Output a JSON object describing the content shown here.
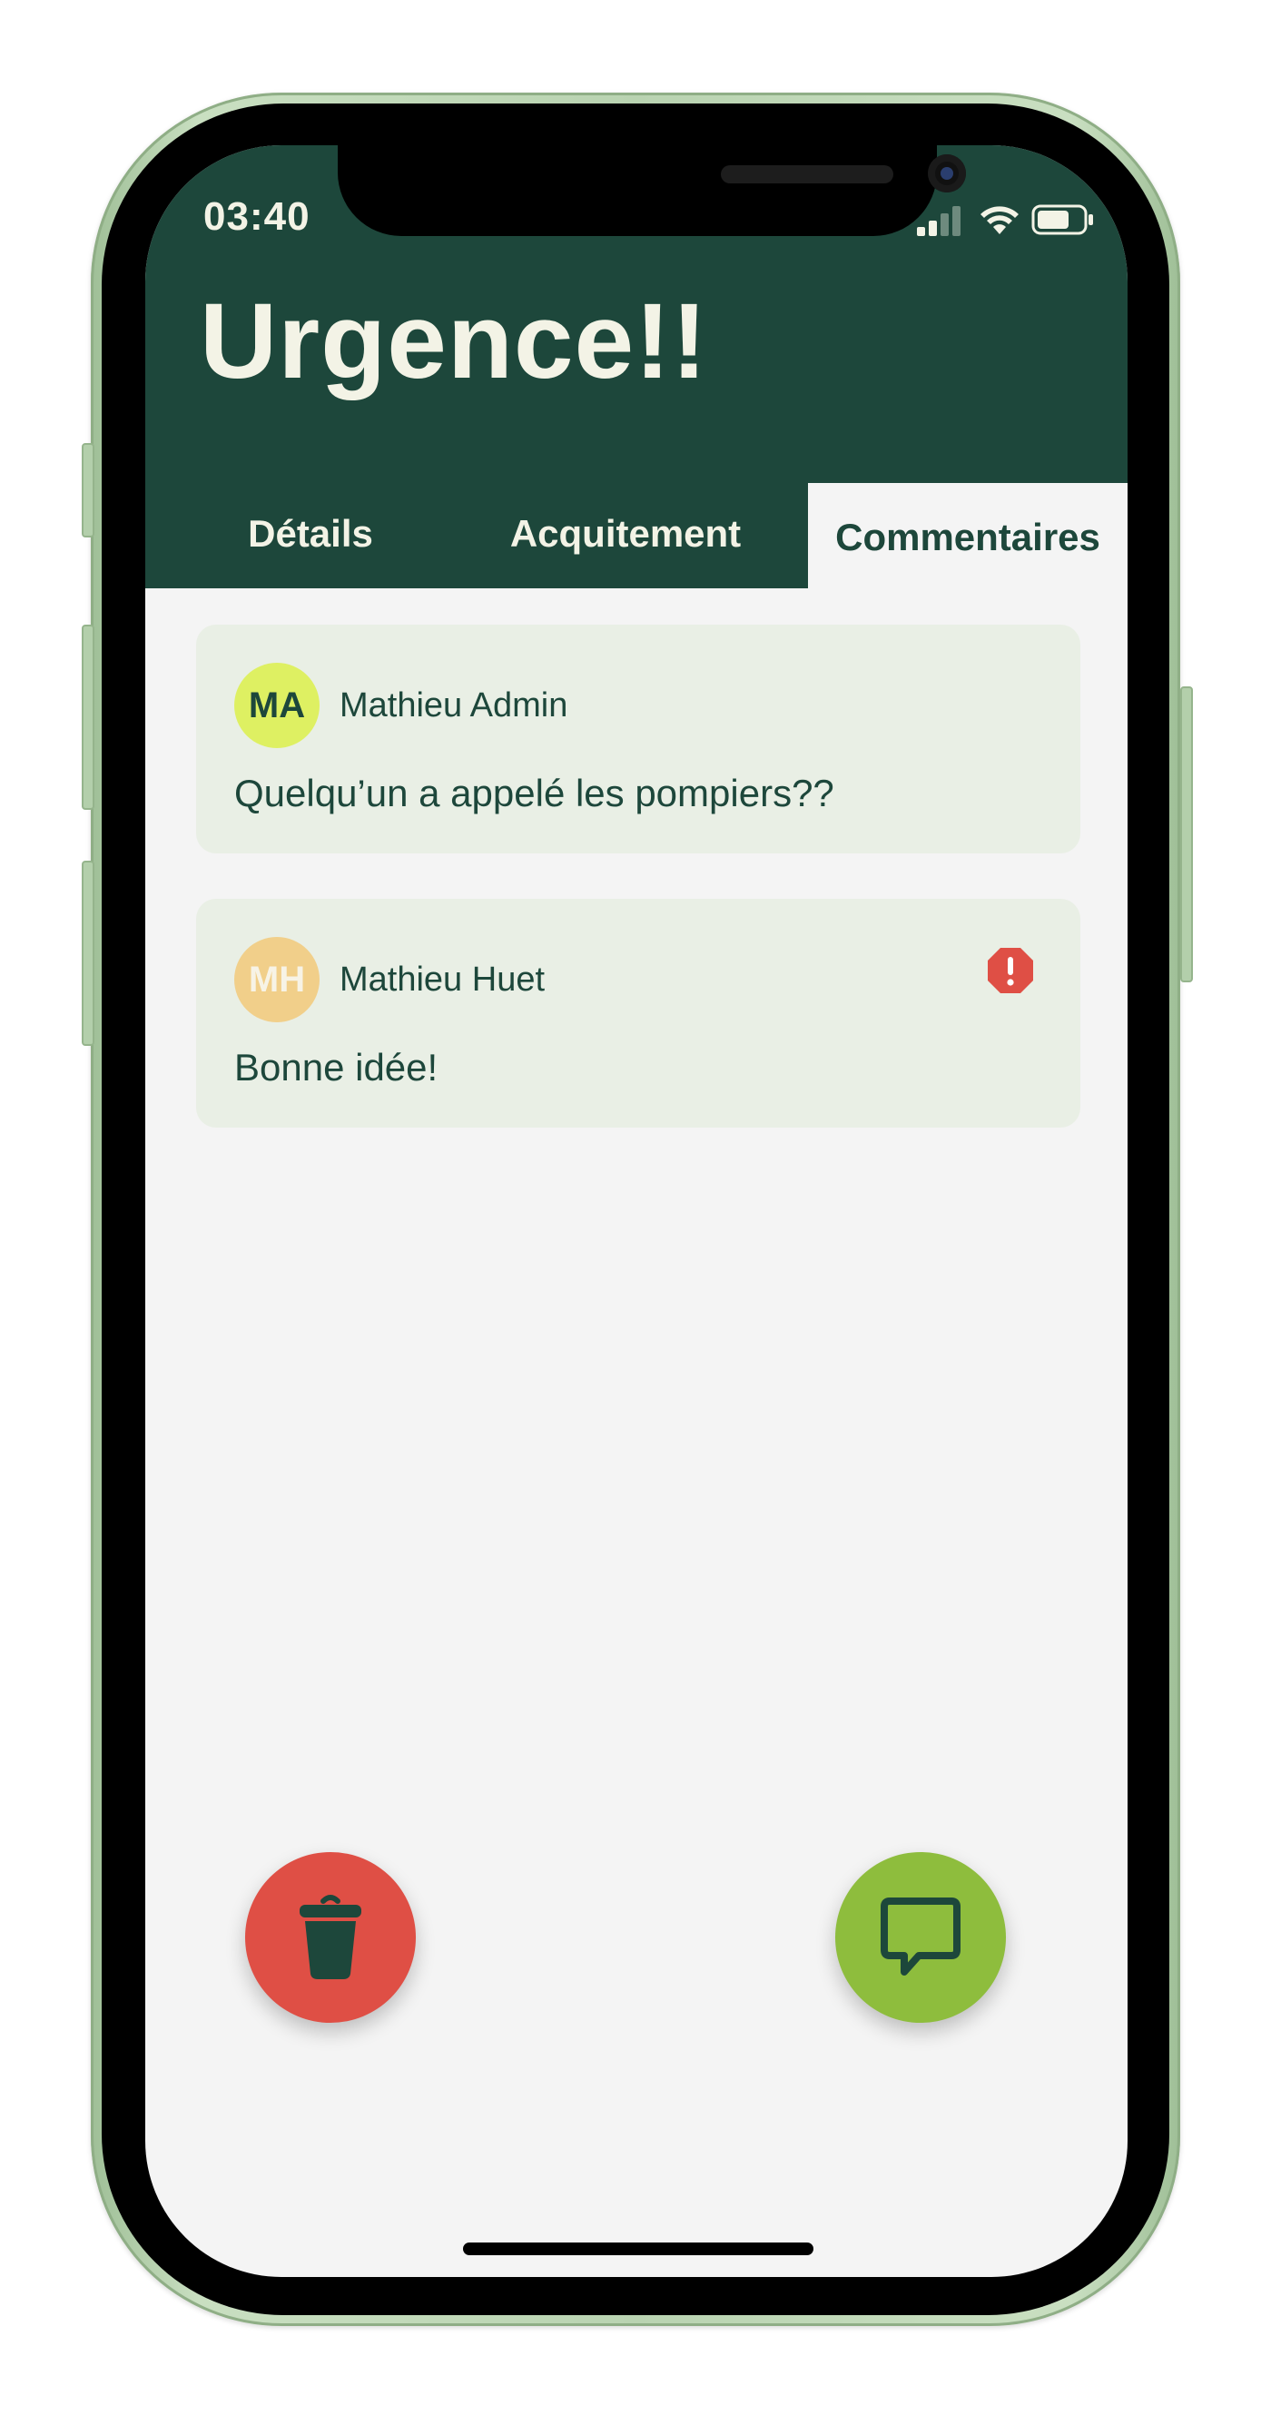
{
  "status_bar": {
    "time": "03:40",
    "icons": [
      "signal-icon",
      "wifi-icon",
      "battery-icon"
    ]
  },
  "header": {
    "title": "Urgence!!",
    "background_color": "#1d473b",
    "text_color": "#f3f3e6"
  },
  "tabs": [
    {
      "label": "Détails",
      "active": false
    },
    {
      "label": "Acquitement",
      "active": false
    },
    {
      "label": "Commentaires",
      "active": true
    }
  ],
  "comments": [
    {
      "initials": "MA",
      "author": "Mathieu Admin",
      "text": "Quelqu’un a appelé les pompiers??",
      "avatar_color": "#def062",
      "initials_color": "#1d473b",
      "alert": false
    },
    {
      "initials": "MH",
      "author": "Mathieu Huet",
      "text": "Bonne idée!",
      "avatar_color": "#f1cf8a",
      "initials_color": "#f7f3e6",
      "alert": true,
      "alert_icon": "error-icon",
      "alert_color": "#df4f45"
    }
  ],
  "actions": {
    "delete": {
      "icon": "trash-icon",
      "color": "#df4f45"
    },
    "comment": {
      "icon": "chat-bubble-icon",
      "color": "#8ebd3d"
    }
  }
}
